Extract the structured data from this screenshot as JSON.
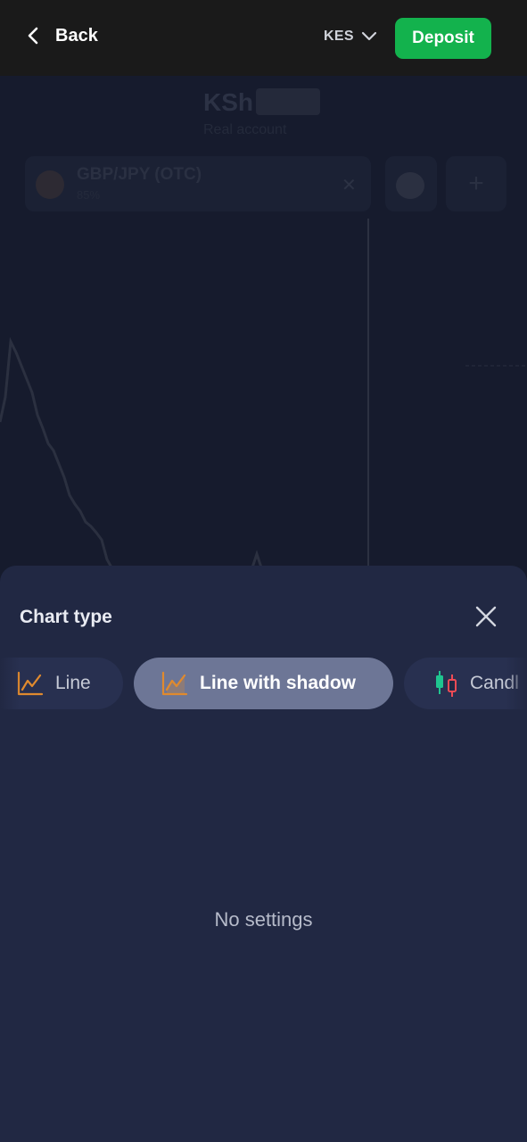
{
  "header": {
    "back_label": "Back",
    "currency_label": "KES",
    "deposit_label": "Deposit"
  },
  "background": {
    "balance_prefix": "KSh",
    "account_label": "Real account",
    "asset_name": "GBP/JPY (OTC)",
    "asset_payout": "85%"
  },
  "sheet": {
    "title": "Chart type",
    "tabs": [
      {
        "label": "Line",
        "icon": "line-chart-icon",
        "selected": false
      },
      {
        "label": "Line with shadow",
        "icon": "line-shadow-chart-icon",
        "selected": true
      },
      {
        "label": "Candl",
        "icon": "candles-icon",
        "selected": false
      }
    ],
    "empty_message": "No settings"
  },
  "colors": {
    "accent_green": "#13b24d",
    "sheet_bg": "#212843",
    "selected_tab": "#6d7696",
    "icon_orange": "#e08a2e"
  }
}
